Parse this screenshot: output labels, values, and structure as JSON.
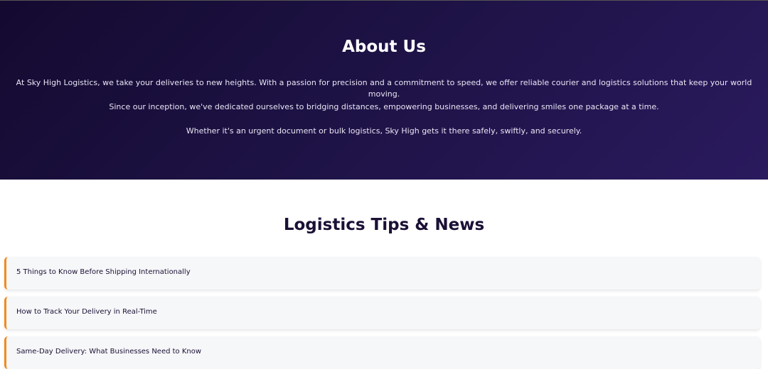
{
  "about": {
    "title": "About Us",
    "paragraphs": [
      "At Sky High Logistics, we take your deliveries to new heights. With a passion for precision and a commitment to speed, we offer reliable courier and logistics solutions that keep your world moving.",
      "Since our inception, we've dedicated ourselves to bridging distances, empowering businesses, and delivering smiles one package at a time.",
      "Whether it's an urgent document or bulk logistics, Sky High gets it there safely, swiftly, and securely."
    ],
    "gradient_colors": [
      "#140a30",
      "#2a1a5e"
    ]
  },
  "tips": {
    "title": "Logistics Tips & News",
    "accent_color": "#f28a1e",
    "items": [
      {
        "label": "5 Things to Know Before Shipping Internationally"
      },
      {
        "label": "How to Track Your Delivery in Real-Time"
      },
      {
        "label": "Same-Day Delivery: What Businesses Need to Know"
      }
    ]
  }
}
